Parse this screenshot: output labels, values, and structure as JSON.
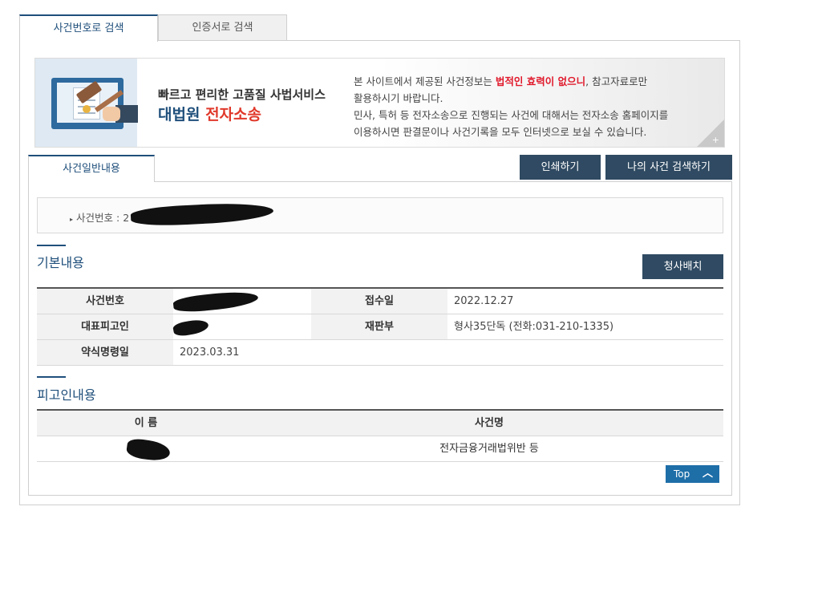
{
  "tabs": {
    "case_number_search": "사건번호로 검색",
    "certificate_search": "인증서로 검색"
  },
  "banner": {
    "title": "빠르고 편리한 고품질 사법서비스",
    "subtitle_part1": "대법원 ",
    "subtitle_part2": "전자소송",
    "desc_line1_a": "본 사이트에서 제공된 사건정보는 ",
    "desc_line1_red": "법적인 효력이 없으니",
    "desc_line1_b": ", 참고자료로만",
    "desc_line2": "활용하시기 바랍니다.",
    "desc_line3": "민사, 특허 등 전자소송으로 진행되는 사건에 대해서는 전자소송 홈페이지를",
    "desc_line4": "이용하시면 판결문이나 사건기록을 모두 인터넷으로 보실 수 있습니다.",
    "plus": "+"
  },
  "sub_tab": "사건일반내용",
  "buttons": {
    "print": "인쇄하기",
    "my_case_search": "나의 사건 검색하기",
    "court_layout": "청사배치",
    "top": "Top"
  },
  "case_label": "사건번호 : ",
  "case_label_visible": "2",
  "basic": {
    "heading": "기본내용",
    "case_number_label": "사건번호",
    "receipt_date_label": "접수일",
    "receipt_date": "2022.12.27",
    "defendant_label": "대표피고인",
    "court_label": "재판부",
    "court_value": "형사35단독 (전화:031-210-1335)",
    "summary_order_label": "약식명령일",
    "summary_order_date": "2023.03.31"
  },
  "defendant": {
    "heading": "피고인내용",
    "col_name": "이 름",
    "col_case_name": "사건명",
    "case_name": "전자금융거래법위반 등"
  },
  "colors": {
    "brand_navy": "#1f4f7b",
    "button_dark": "#2f4a62",
    "red": "#e0392b",
    "top_button": "#1e6ea8"
  },
  "icons": [
    "gavel-icon",
    "chevron-up-icon"
  ]
}
